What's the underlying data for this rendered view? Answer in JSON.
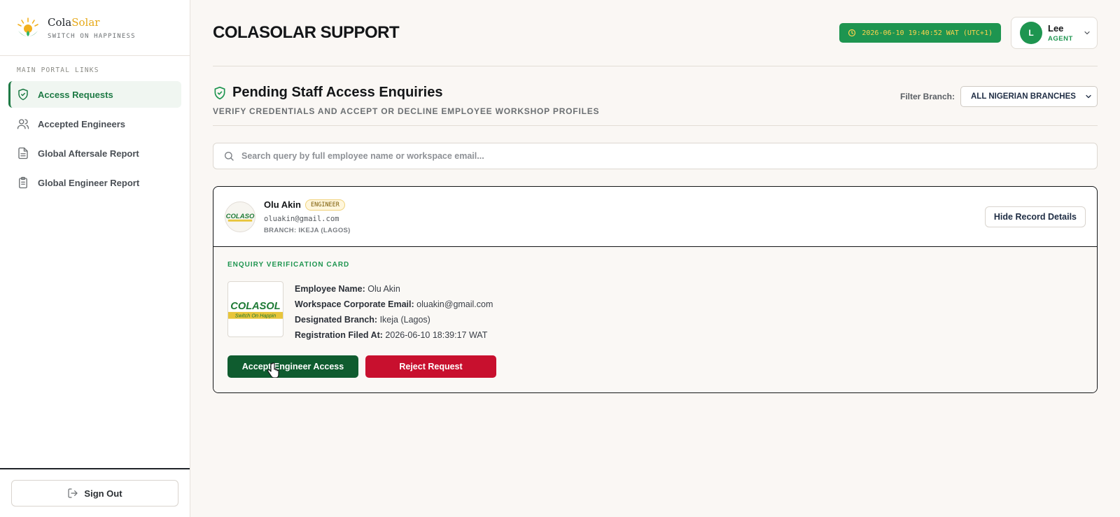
{
  "brand": {
    "name_primary": "Cola",
    "name_accent": "Solar",
    "tagline": "SWITCH ON HAPPINESS"
  },
  "sidebar": {
    "section_label": "MAIN PORTAL LINKS",
    "items": [
      {
        "label": "Access Requests",
        "icon": "shield-check-icon",
        "active": true
      },
      {
        "label": "Accepted Engineers",
        "icon": "users-icon",
        "active": false
      },
      {
        "label": "Global Aftersale Report",
        "icon": "document-icon",
        "active": false
      },
      {
        "label": "Global Engineer Report",
        "icon": "clipboard-icon",
        "active": false
      }
    ],
    "signout_label": "Sign Out"
  },
  "header": {
    "title": "COLASOLAR SUPPORT",
    "clock": "2026-06-10 19:40:52 WAT (UTC+1)",
    "user": {
      "initial": "L",
      "name": "Lee",
      "role": "AGENT"
    }
  },
  "section": {
    "title": "Pending Staff Access Enquiries",
    "subtitle": "VERIFY CREDENTIALS AND ACCEPT OR DECLINE EMPLOYEE WORKSHOP PROFILES",
    "filter_label": "Filter Branch:",
    "filter_value": "ALL NIGERIAN BRANCHES"
  },
  "search": {
    "placeholder": "Search query by full employee name or workspace email..."
  },
  "record": {
    "name": "Olu Akin",
    "role_badge": "ENGINEER",
    "email": "oluakin@gmail.com",
    "branch": "BRANCH: IKEJA (LAGOS)",
    "toggle_label": "Hide Record Details",
    "card_title": "ENQUIRY VERIFICATION CARD",
    "fields": {
      "name_label": "Employee Name:",
      "name_value": "Olu Akin",
      "email_label": "Workspace Corporate Email:",
      "email_value": "oluakin@gmail.com",
      "branch_label": "Designated Branch:",
      "branch_value": "Ikeja (Lagos)",
      "filed_label": "Registration Filed At:",
      "filed_value": "2026-06-10 18:39:17 WAT"
    },
    "accept_label": "Accept Engineer Access",
    "reject_label": "Reject Request"
  },
  "colors": {
    "brand_green": "#1e9550",
    "dark_green": "#0f5c2f",
    "reject_red": "#c8102e",
    "gold": "#e6a817"
  }
}
